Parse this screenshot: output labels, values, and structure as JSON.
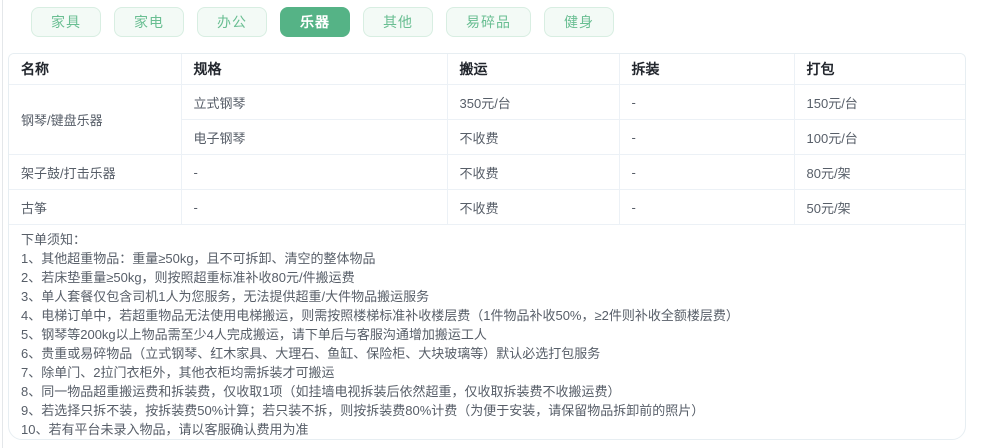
{
  "tabs": {
    "items": [
      {
        "label": "家具",
        "active": false
      },
      {
        "label": "家电",
        "active": false
      },
      {
        "label": "办公",
        "active": false
      },
      {
        "label": "乐器",
        "active": true
      },
      {
        "label": "其他",
        "active": false
      },
      {
        "label": "易碎品",
        "active": false
      },
      {
        "label": "健身",
        "active": false
      }
    ]
  },
  "table": {
    "headers": [
      "名称",
      "规格",
      "搬运",
      "拆装",
      "打包"
    ],
    "rows": [
      {
        "name": "钢琴/键盘乐器",
        "spec": "立式钢琴",
        "move": "350元/台",
        "disassemble": "-",
        "pack": "150元/台"
      },
      {
        "spec": "电子钢琴",
        "move": "不收费",
        "disassemble": "-",
        "pack": "100元/台"
      },
      {
        "name": "架子鼓/打击乐器",
        "spec": "-",
        "move": "不收费",
        "disassemble": "-",
        "pack": "80元/架"
      },
      {
        "name": "古筝",
        "spec": "-",
        "move": "不收费",
        "disassemble": "-",
        "pack": "50元/架"
      }
    ]
  },
  "notes": {
    "title": "下单须知：",
    "items": [
      "1、其他超重物品：重量≥50kg，且不可拆卸、清空的整体物品",
      "2、若床垫重量≥50kg，则按照超重标准补收80元/件搬运费",
      "3、单人套餐仅包含司机1人为您服务，无法提供超重/大件物品搬运服务",
      "4、电梯订单中，若超重物品无法使用电梯搬运，则需按照楼梯标准补收楼层费（1件物品补收50%，≥2件则补收全额楼层费）",
      "5、钢琴等200kg以上物品需至少4人完成搬运，请下单后与客服沟通增加搬运工人",
      "6、贵重或易碎物品（立式钢琴、红木家具、大理石、鱼缸、保险柜、大块玻璃等）默认必选打包服务",
      "7、除单门、2拉门衣柜外，其他衣柜均需拆装才可搬运",
      "8、同一物品超重搬运费和拆装费，仅收取1项（如挂墙电视拆装后依然超重，仅收取拆装费不收搬运费）",
      "9、若选择只拆不装，按拆装费50%计算；若只装不拆，则按拆装费80%计费（为便于安装，请保留物品拆卸前的照片）",
      "10、若有平台未录入物品，请以客服确认费用为准"
    ]
  },
  "colors": {
    "accent_green": "#55b386",
    "tab_inactive_bg": "#f3faf6",
    "tab_inactive_border": "#d8eee2",
    "tab_inactive_text": "#69be92",
    "table_border": "#ecf1f6",
    "header_text": "#23272e",
    "body_text": "#575e68"
  }
}
